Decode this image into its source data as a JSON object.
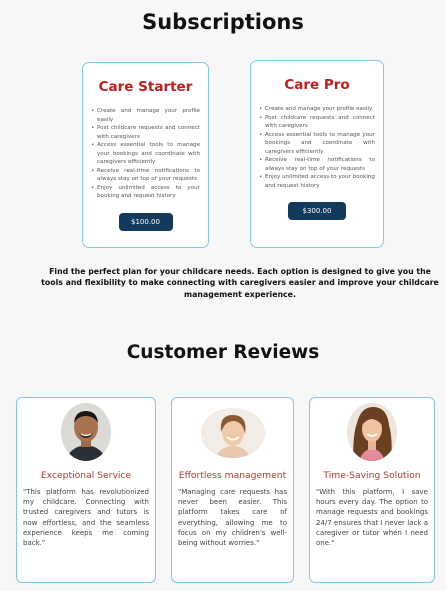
{
  "header": {
    "title": "Subscriptions"
  },
  "plans": [
    {
      "name": "Care Starter",
      "features": [
        "Create and manage your profile easily",
        "Post childcare requests and connect with caregivers",
        "Access essential tools to manage your bookings and coordinate with caregivers efficiently",
        "Receive real-time notifications to always stay on top of your requests",
        "Enjoy unlimited access to your booking and request history"
      ],
      "price_label": "$100.00"
    },
    {
      "name": "Care Pro",
      "features": [
        "Create and manage your profile easily",
        "Post childcare requests and connect with caregivers",
        "Access essential tools to manage your bookings and coordinate with caregivers efficiently",
        "Receive real-time notifications to always stay on top of your requests",
        "Enjoy unlimited access to your booking and request history"
      ],
      "price_label": "$300.00"
    }
  ],
  "plans_description": "Find the perfect plan for your childcare needs. Each option is designed to give you the tools and flexibility to make connecting with caregivers easier and improve your childcare management experience.",
  "reviews": {
    "title": "Customer Reviews",
    "items": [
      {
        "title": "Exceptional Service",
        "text": "\"This platform has revolutionized my childcare. Connecting with trusted caregivers and tutors is now effortless, and the seamless experience keeps me coming back.\""
      },
      {
        "title": "Effortless management",
        "text": "\"Managing care requests has never been easier. This platform takes care of everything, allowing me to focus on my children's well-being without worries.\""
      },
      {
        "title": "Time-Saving Solution",
        "text": "\"With this platform, I save hours every day. The option to manage requests and bookings 24/7 ensures that I never lack a caregiver or tutor when I need one.\""
      }
    ]
  },
  "colors": {
    "plan_name": "#c8191b",
    "card_border": "#7fc8ee",
    "button_bg": "#123a5c",
    "review_title": "#b03a2e"
  }
}
